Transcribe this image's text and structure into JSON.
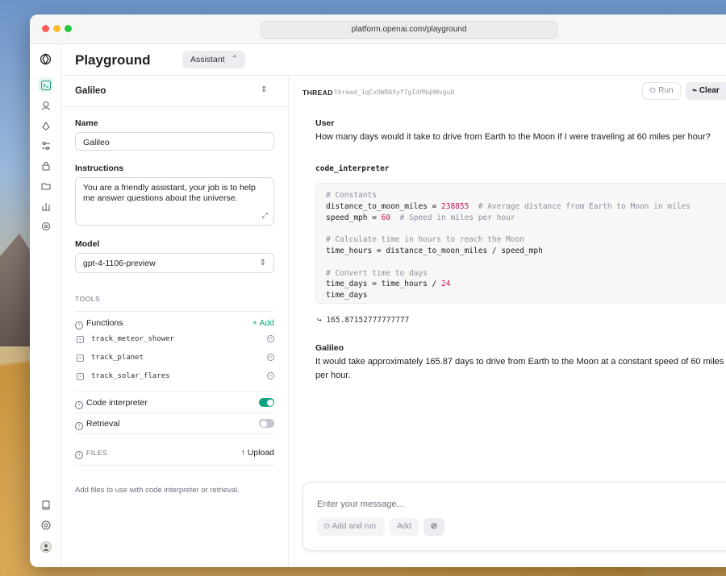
{
  "browser": {
    "url": "platform.openai.com/playground"
  },
  "header": {
    "title": "Playground",
    "mode": "Assistant"
  },
  "assistant": {
    "name": "Galileo",
    "name_label": "Name",
    "name_value": "Galileo",
    "instructions_label": "Instructions",
    "instructions_value": "You are a friendly assistant, your job is to help me answer questions about the universe.",
    "model_label": "Model",
    "model_value": "gpt-4-1106-preview"
  },
  "tools": {
    "section_label": "TOOLS",
    "functions_label": "Functions",
    "add_label": "+ Add",
    "functions": [
      "track_meteor_shower",
      "track_planet",
      "track_solar_flares"
    ],
    "code_interpreter_label": "Code interpreter",
    "code_interpreter_enabled": true,
    "retrieval_label": "Retrieval",
    "retrieval_enabled": false
  },
  "files": {
    "label": "FILES",
    "upload_label": "Upload",
    "hint": "Add files to use with code interpreter or retrieval."
  },
  "thread": {
    "label": "THREAD",
    "id": "thread_1qCvOW8AXyf7gIdPNqHNvgu8",
    "run_label": "Run",
    "clear_label": "Clear",
    "user_role": "User",
    "user_message": "How many days would it take to drive from Earth to the Moon if I were traveling at 60 miles per hour?",
    "tool_name": "code_interpreter",
    "code": {
      "l1": "# Constants",
      "l2a": "distance_to_moon_miles = ",
      "l2n": "238855",
      "l2c": "  # Average distance from Earth to Moon in miles",
      "l3a": "speed_mph = ",
      "l3n": "60",
      "l3c": "  # Speed in miles per hour",
      "l5": "# Calculate time in hours to reach the Moon",
      "l6": "time_hours = distance_to_moon_miles / speed_mph",
      "l8": "# Convert time to days",
      "l9a": "time_days = time_hours / ",
      "l9n": "24",
      "l10": "time_days"
    },
    "result": "↪ 165.87152777777777",
    "assistant_role": "Galileo",
    "assistant_message": "It would take approximately 165.87 days to drive from Earth to the Moon at a constant speed of 60 miles per hour."
  },
  "composer": {
    "placeholder": "Enter your message...",
    "add_and_run_label": "Add and run",
    "add_label": "Add"
  }
}
